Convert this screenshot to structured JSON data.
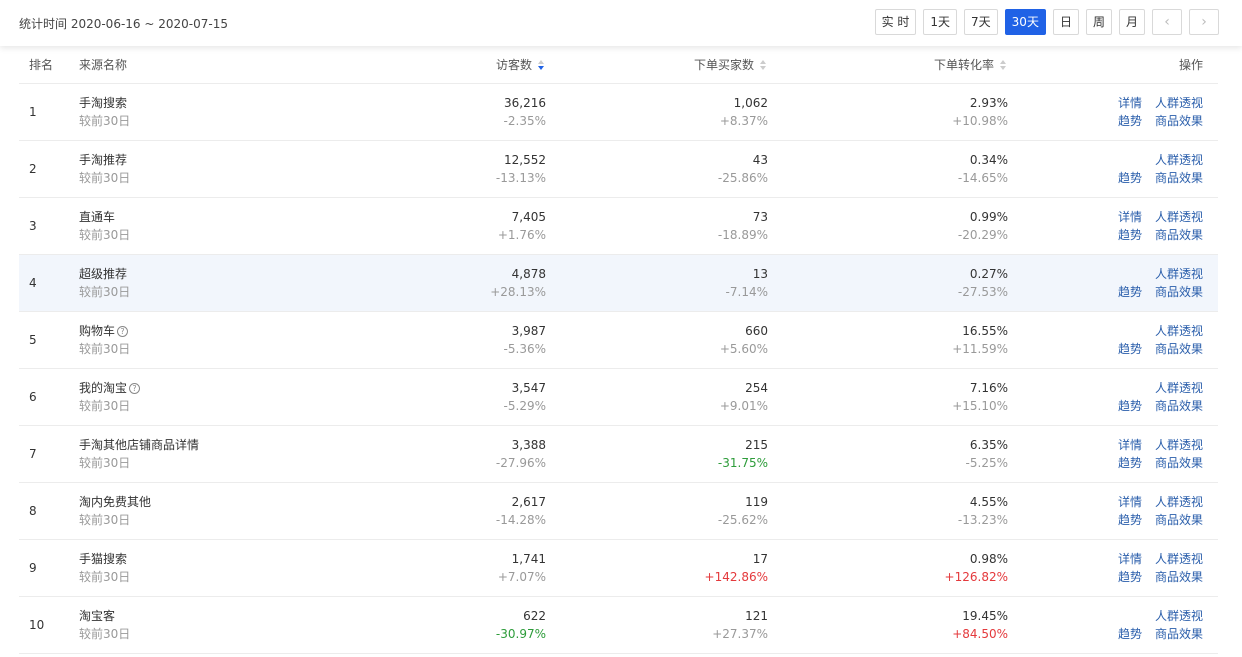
{
  "header": {
    "stat_time": "统计时间 2020-06-16 ~ 2020-07-15",
    "ranges": [
      "实 时",
      "1天",
      "7天",
      "30天",
      "日",
      "周",
      "月"
    ],
    "active_range": "30天",
    "prev_icon": "chevron-left-icon",
    "next_icon": "chevron-right-icon"
  },
  "columns": {
    "rank": "排名",
    "source": "来源名称",
    "visitors": "访客数",
    "buyers": "下单买家数",
    "conversion": "下单转化率",
    "actions": "操作"
  },
  "compare_label": "较前30日",
  "actions": {
    "detail": "详情",
    "crowd": "人群透视",
    "trend": "趋势",
    "product": "商品效果"
  },
  "colors": {
    "accent": "#2062e6",
    "link": "#2a5eab",
    "up": "#e4393c",
    "down": "#2d9c3a",
    "highlight": "#f2f6fc"
  },
  "rows": [
    {
      "rank": "1",
      "name": "手淘搜索",
      "help": false,
      "visitors": "36,216",
      "visitors_change": "-2.35%",
      "buyers": "1,062",
      "buyers_change": "+8.37%",
      "conversion": "2.93%",
      "conversion_change": "+10.98%",
      "has_detail": true
    },
    {
      "rank": "2",
      "name": "手淘推荐",
      "help": false,
      "visitors": "12,552",
      "visitors_change": "-13.13%",
      "buyers": "43",
      "buyers_change": "-25.86%",
      "conversion": "0.34%",
      "conversion_change": "-14.65%",
      "has_detail": false
    },
    {
      "rank": "3",
      "name": "直通车",
      "help": false,
      "visitors": "7,405",
      "visitors_change": "+1.76%",
      "buyers": "73",
      "buyers_change": "-18.89%",
      "conversion": "0.99%",
      "conversion_change": "-20.29%",
      "has_detail": true
    },
    {
      "rank": "4",
      "name": "超级推荐",
      "help": false,
      "visitors": "4,878",
      "visitors_change": "+28.13%",
      "buyers": "13",
      "buyers_change": "-7.14%",
      "conversion": "0.27%",
      "conversion_change": "-27.53%",
      "has_detail": false,
      "highlight": true
    },
    {
      "rank": "5",
      "name": "购物车",
      "help": true,
      "visitors": "3,987",
      "visitors_change": "-5.36%",
      "buyers": "660",
      "buyers_change": "+5.60%",
      "conversion": "16.55%",
      "conversion_change": "+11.59%",
      "has_detail": false
    },
    {
      "rank": "6",
      "name": "我的淘宝",
      "help": true,
      "visitors": "3,547",
      "visitors_change": "-5.29%",
      "buyers": "254",
      "buyers_change": "+9.01%",
      "conversion": "7.16%",
      "conversion_change": "+15.10%",
      "has_detail": false
    },
    {
      "rank": "7",
      "name": "手淘其他店铺商品详情",
      "help": false,
      "visitors": "3,388",
      "visitors_change": "-27.96%",
      "buyers": "215",
      "buyers_change": "-31.75%",
      "buyers_change_color": "green",
      "conversion": "6.35%",
      "conversion_change": "-5.25%",
      "has_detail": true
    },
    {
      "rank": "8",
      "name": "淘内免费其他",
      "help": false,
      "visitors": "2,617",
      "visitors_change": "-14.28%",
      "buyers": "119",
      "buyers_change": "-25.62%",
      "conversion": "4.55%",
      "conversion_change": "-13.23%",
      "has_detail": true
    },
    {
      "rank": "9",
      "name": "手猫搜索",
      "help": false,
      "visitors": "1,741",
      "visitors_change": "+7.07%",
      "buyers": "17",
      "buyers_change": "+142.86%",
      "buyers_change_color": "red",
      "conversion": "0.98%",
      "conversion_change": "+126.82%",
      "conversion_change_color": "red",
      "has_detail": true
    },
    {
      "rank": "10",
      "name": "淘宝客",
      "help": false,
      "visitors": "622",
      "visitors_change": "-30.97%",
      "visitors_change_color": "green",
      "buyers": "121",
      "buyers_change": "+27.37%",
      "conversion": "19.45%",
      "conversion_change": "+84.50%",
      "conversion_change_color": "red",
      "has_detail": false
    }
  ]
}
